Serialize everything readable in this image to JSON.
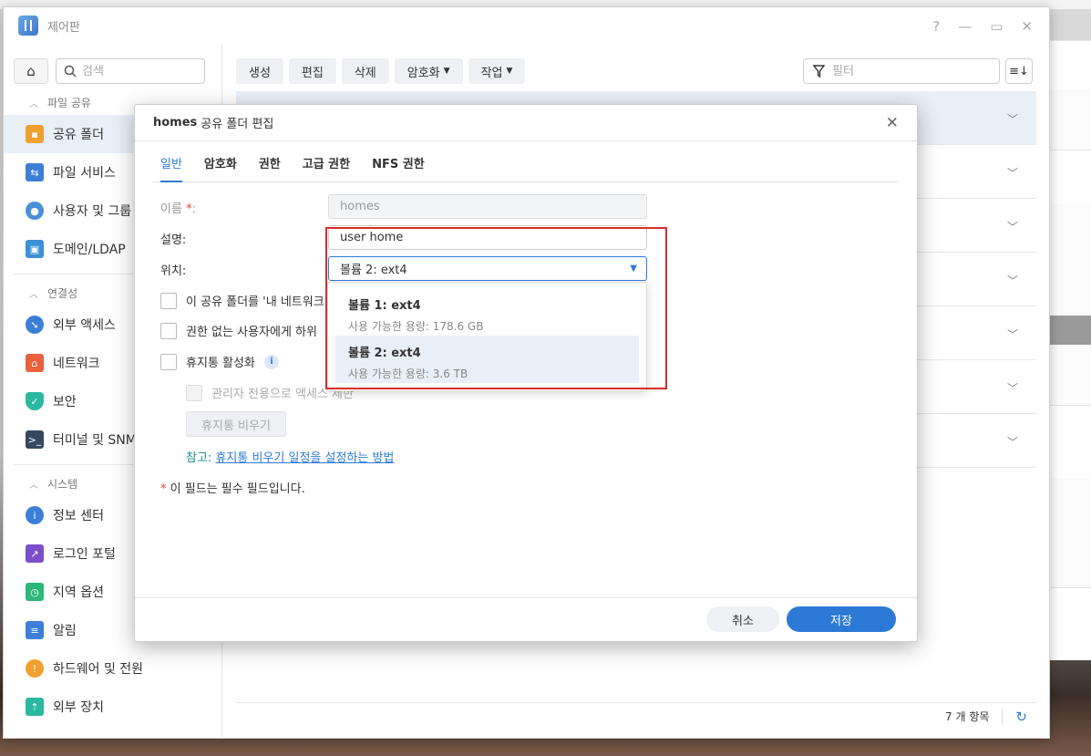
{
  "window": {
    "title": "제어판"
  },
  "window_controls": {
    "help": "?",
    "minimize": "—",
    "maximize": "▭",
    "close": "✕"
  },
  "sidebar": {
    "search_placeholder": "검색",
    "sections": [
      {
        "title": "파일 공유",
        "items": [
          "공유 폴더",
          "파일 서비스",
          "사용자 및 그룹",
          "도메인/LDAP"
        ]
      },
      {
        "title": "연결성",
        "items": [
          "외부 액세스",
          "네트워크",
          "보안",
          "터미널 및 SNMP"
        ]
      },
      {
        "title": "시스템",
        "items": [
          "정보 센터",
          "로그인 포털",
          "지역 옵션",
          "알림",
          "하드웨어 및 전원",
          "외부 장치"
        ]
      }
    ]
  },
  "toolbar": {
    "create": "생성",
    "edit": "편집",
    "delete": "삭제",
    "encrypt": "암호화",
    "action": "작업",
    "filter_placeholder": "필터"
  },
  "list": {
    "count_label": "7 개 항목"
  },
  "dialog": {
    "title_bold": "homes",
    "title_rest": "공유 폴더 편집",
    "tabs": [
      "일반",
      "암호화",
      "권한",
      "고급 권한",
      "NFS 권한"
    ],
    "name_label": "이름",
    "name_value": "homes",
    "desc_label": "설명:",
    "desc_value": "user home",
    "location_label": "위치:",
    "location_value": "볼륨 2:  ext4",
    "checkbox_1": "이 공유 폴더를 '내 네트워크",
    "checkbox_2": "권한 없는 사용자에게 하위",
    "checkbox_3": "휴지통 활성화",
    "checkbox_3a": "관리자 전용으로 액세스 제한",
    "empty_bin": "휴지통 비우기",
    "note_prefix": "참고:",
    "note_link": "휴지통 비우기 일정을 설정하는 방법",
    "required_note": "이 필드는 필수 필드입니다.",
    "cancel": "취소",
    "save": "저장",
    "options": [
      {
        "name": "볼륨 1: ext4",
        "sub": "사용 가능한 용량: 178.6 GB"
      },
      {
        "name": "볼륨 2: ext4",
        "sub": "사용 가능한 용량: 3.6 TB"
      }
    ]
  },
  "colors": {
    "accent": "#2d7ad6",
    "highlight_box": "#d62d2d",
    "required": "#e0443a"
  }
}
